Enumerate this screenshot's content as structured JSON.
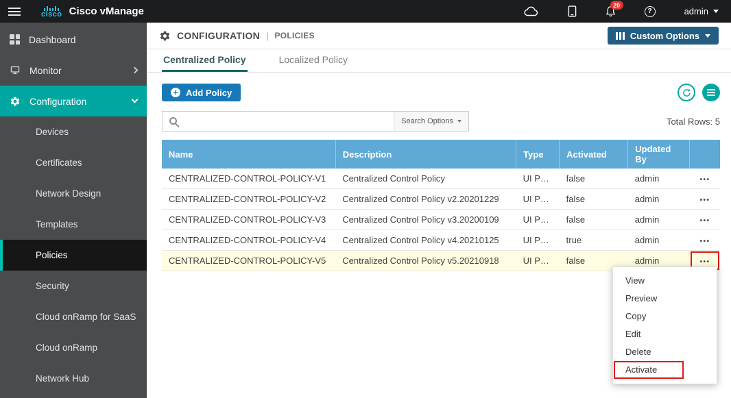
{
  "topbar": {
    "logo_text": "cisco",
    "brand": "Cisco vManage",
    "notifications_count": "20",
    "user": "admin"
  },
  "sidebar": {
    "items": [
      {
        "label": "Dashboard",
        "icon": "dashboard-grid-icon"
      },
      {
        "label": "Monitor",
        "icon": "monitor-icon"
      },
      {
        "label": "Configuration",
        "icon": "gear-icon"
      }
    ],
    "subitems": [
      "Devices",
      "Certificates",
      "Network Design",
      "Templates",
      "Policies",
      "Security",
      "Cloud onRamp for SaaS",
      "Cloud onRamp",
      "Network Hub"
    ],
    "active_subitem": "Policies"
  },
  "header": {
    "title": "CONFIGURATION",
    "separator": "|",
    "subtitle": "POLICIES",
    "custom_options_label": "Custom Options"
  },
  "tabs": [
    {
      "label": "Centralized Policy",
      "active": true
    },
    {
      "label": "Localized Policy",
      "active": false
    }
  ],
  "toolbar": {
    "add_policy_label": "Add Policy",
    "search_options_label": "Search Options",
    "total_rows_label": "Total Rows: 5"
  },
  "table": {
    "columns": [
      "Name",
      "Description",
      "Type",
      "Activated",
      "Updated By"
    ],
    "rows": [
      {
        "name": "CENTRALIZED-CONTROL-POLICY-V1",
        "description": "Centralized Control Policy",
        "type": "UI Poli...",
        "activated": "false",
        "updated_by": "admin"
      },
      {
        "name": "CENTRALIZED-CONTROL-POLICY-V2",
        "description": "Centralized Control Policy v2.20201229",
        "type": "UI Poli...",
        "activated": "false",
        "updated_by": "admin"
      },
      {
        "name": "CENTRALIZED-CONTROL-POLICY-V3",
        "description": "Centralized Control Policy v3.20200109",
        "type": "UI Poli...",
        "activated": "false",
        "updated_by": "admin"
      },
      {
        "name": "CENTRALIZED-CONTROL-POLICY-V4",
        "description": "Centralized Control Policy v4.20210125",
        "type": "UI Poli...",
        "activated": "true",
        "updated_by": "admin"
      },
      {
        "name": "CENTRALIZED-CONTROL-POLICY-V5",
        "description": "Centralized Control Policy v5.20210918",
        "type": "UI Poli...",
        "activated": "false",
        "updated_by": "admin"
      }
    ],
    "highlighted_row": "CENTRALIZED-CONTROL-POLICY-V5"
  },
  "context_menu": {
    "items": [
      "View",
      "Preview",
      "Copy",
      "Edit",
      "Delete",
      "Activate"
    ],
    "annotated_item": "Activate"
  },
  "colors": {
    "teal_accent": "#00a7a1",
    "table_header_blue": "#5ea9d6",
    "primary_button_blue": "#1779b8",
    "custom_options_blue": "#235d82",
    "annotation_red": "#dd1b14",
    "highlight_row_yellow": "#fffde1"
  }
}
